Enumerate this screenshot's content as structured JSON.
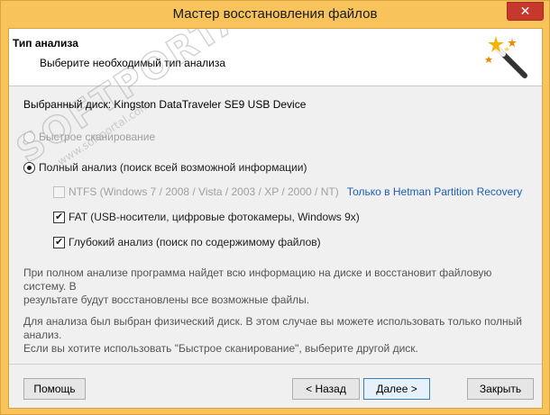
{
  "window": {
    "title": "Мастер восстановления файлов",
    "close_symbol": "✕"
  },
  "header": {
    "title": "Тип анализа",
    "subtitle": "Выберите необходимый тип анализа",
    "icon": "magic-wand-icon"
  },
  "watermark": {
    "text": "SOFTPORTAL",
    "url": "www.softportal.com"
  },
  "disk": {
    "label": "Выбранный диск: Kingston DataTraveler SE9 USB Device"
  },
  "options": {
    "quick_scan": {
      "label": "Быстрое сканирование",
      "checked": false,
      "disabled": true
    },
    "full_analysis": {
      "label": "Полный анализ (поиск всей возможной информации)",
      "checked": true,
      "disabled": false
    },
    "ntfs": {
      "label": "NTFS (Windows 7 / 2008 / Vista / 2003 / XP / 2000 / NT)",
      "checked": false,
      "disabled": true,
      "link": "Только в Hetman Partition Recovery"
    },
    "fat": {
      "label": "FAT (USB-носители, цифровые фотокамеры, Windows 9x)",
      "checked": true,
      "disabled": false
    },
    "deep": {
      "label": "Глубокий анализ (поиск по содержимому файлов)",
      "checked": true,
      "disabled": false
    }
  },
  "info": {
    "p1_line1": "При полном анализе программа найдет всю информацию на диске и восстановит файловую систему. В",
    "p1_line2": "результате будут восстановлены все возможные файлы.",
    "p2_line1": "Для анализа был выбран физический диск. В этом случае вы можете использовать только полный анализ.",
    "p2_line2": "Если вы хотите использовать \"Быстрое сканирование\", выберите другой диск."
  },
  "buttons": {
    "help": "Помощь",
    "back": "< Назад",
    "next": "Далее >",
    "close": "Закрыть"
  },
  "colors": {
    "frame": "#f7c35a",
    "close_button": "#c7382c",
    "link": "#1c5fb4"
  }
}
